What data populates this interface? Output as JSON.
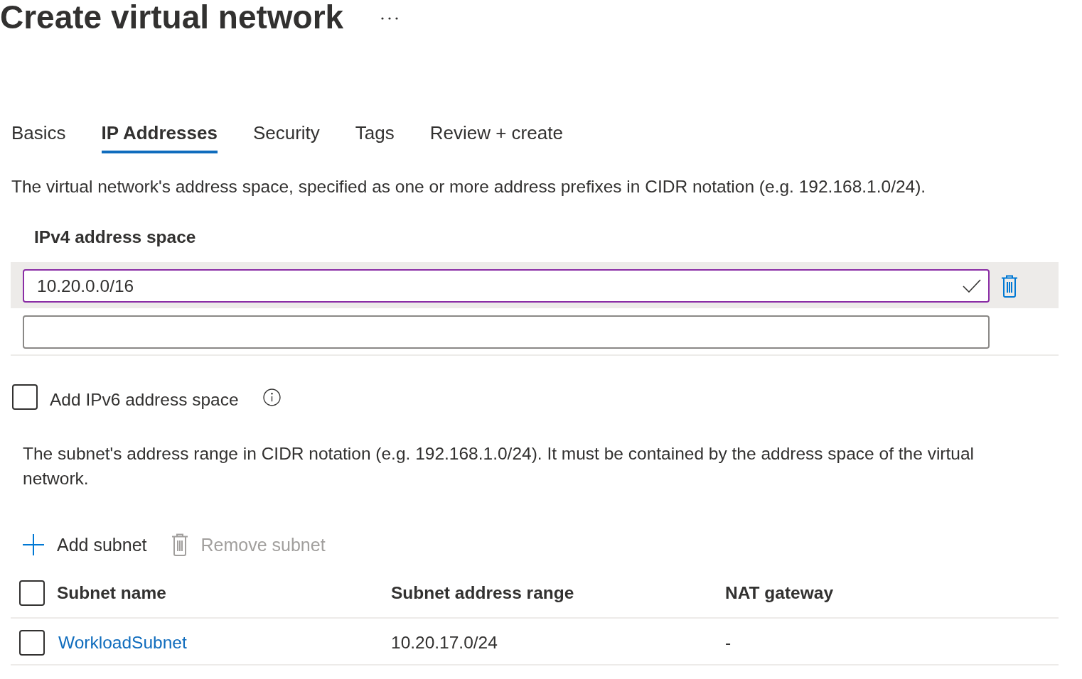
{
  "page": {
    "title": "Create virtual network"
  },
  "tabs": [
    {
      "label": "Basics",
      "selected": false
    },
    {
      "label": "IP Addresses",
      "selected": true
    },
    {
      "label": "Security",
      "selected": false
    },
    {
      "label": "Tags",
      "selected": false
    },
    {
      "label": "Review + create",
      "selected": false
    }
  ],
  "description": "The virtual network's address space, specified as one or more address prefixes in CIDR notation (e.g. 192.168.1.0/24).",
  "ipv4_address_space": {
    "label": "IPv4 address space",
    "fields": [
      {
        "value": "10.20.0.0/16",
        "selected": true,
        "valid": true
      },
      {
        "selected": false,
        "valid": false
      }
    ]
  },
  "ipv6_option": {
    "label": "Add IPv6 address space",
    "checked": false
  },
  "subnet_description": "The subnet's address range in CIDR notation (e.g. 192.168.1.0/24). It must be contained by the address space of the virtual network.",
  "toolbar": [
    {
      "kind": "add",
      "label": "Add subnet",
      "disabled": false
    },
    {
      "kind": "remove",
      "label": "Remove subnet",
      "disabled": true
    }
  ],
  "table": {
    "select_all_checked": false,
    "columns": [
      "Subnet name",
      "Subnet address range",
      "NAT gateway"
    ],
    "rows": [
      {
        "name": "WorkloadSubnet",
        "address_range": "10.20.17.0/24",
        "nat_gateway": "-",
        "checked": false
      }
    ]
  }
}
